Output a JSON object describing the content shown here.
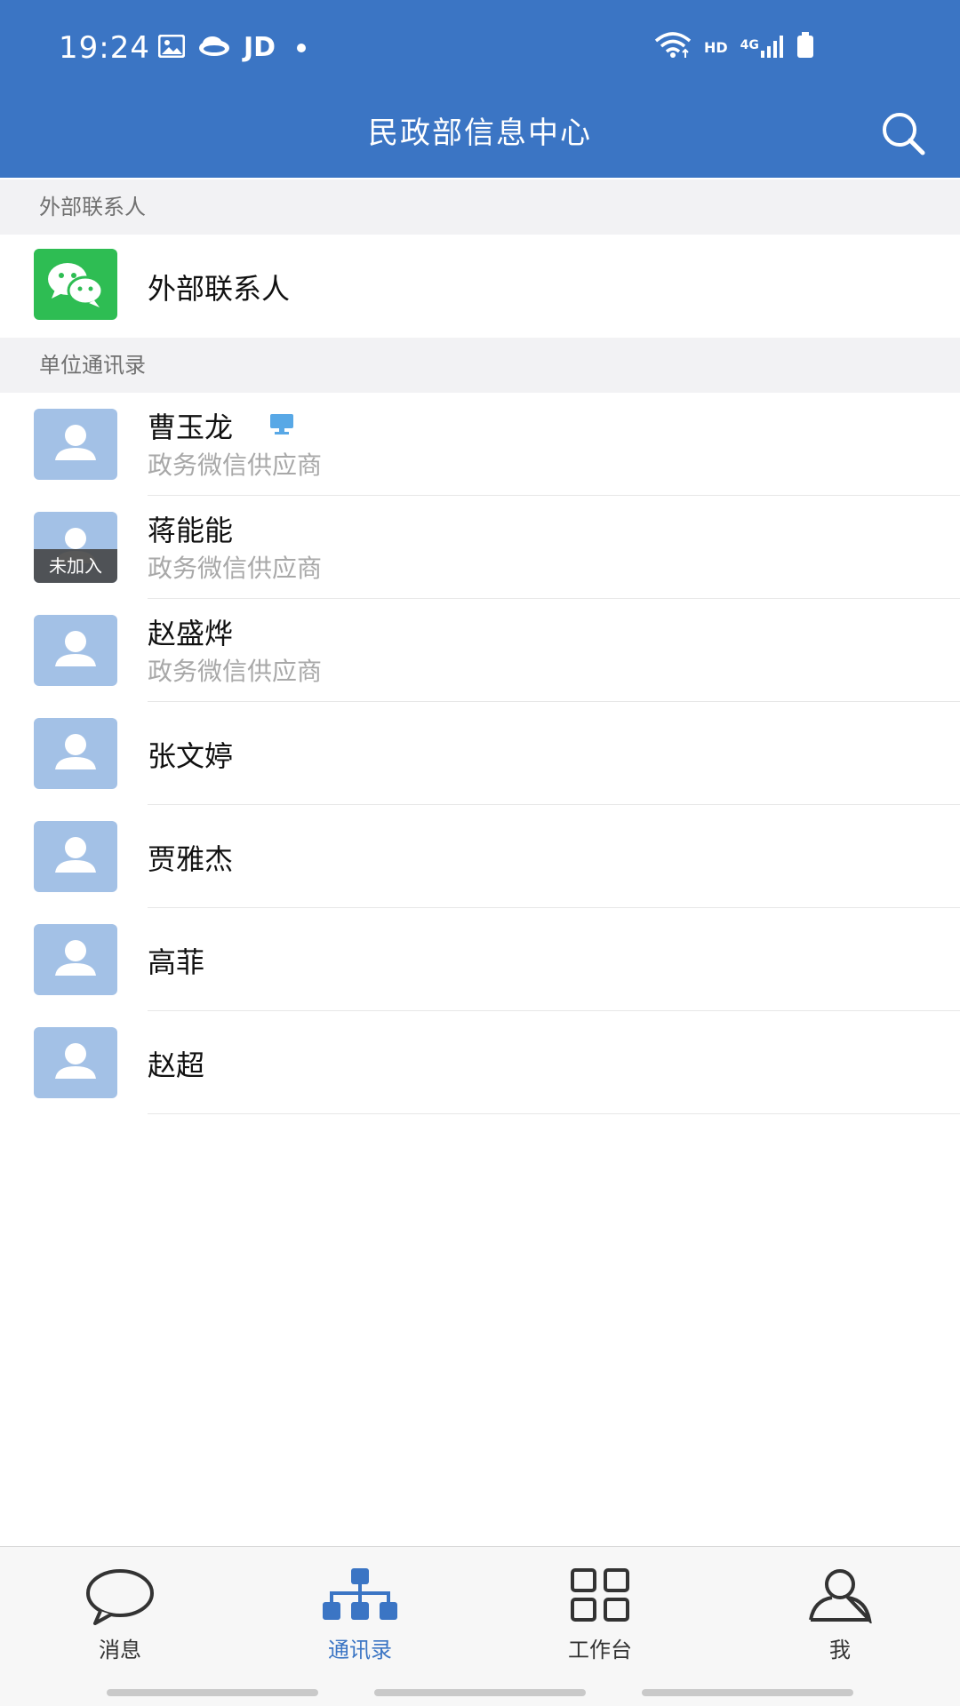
{
  "status": {
    "time": "19:24",
    "jd_label": "JD",
    "hd_label": "HD",
    "network_label": "4G"
  },
  "header": {
    "title": "民政部信息中心",
    "search_icon": "search-icon"
  },
  "sections": {
    "external": {
      "title": "外部联系人",
      "item_label": "外部联系人"
    },
    "unit": {
      "title": "单位通讯录"
    }
  },
  "contacts": [
    {
      "name": "曹玉龙",
      "subtitle": "政务微信供应商",
      "pc_online": true
    },
    {
      "name": "蒋能能",
      "subtitle": "政务微信供应商",
      "badge": "未加入"
    },
    {
      "name": "赵盛烨",
      "subtitle": "政务微信供应商"
    },
    {
      "name": "张文婷"
    },
    {
      "name": "贾雅杰"
    },
    {
      "name": "高菲"
    },
    {
      "name": "赵超"
    }
  ],
  "tabbar": {
    "tabs": [
      {
        "label": "消息",
        "icon": "chat-bubble-icon"
      },
      {
        "label": "通讯录",
        "icon": "org-chart-icon",
        "active": true
      },
      {
        "label": "工作台",
        "icon": "grid-icon"
      },
      {
        "label": "我",
        "icon": "person-outline-icon"
      }
    ]
  },
  "colors": {
    "brand_blue": "#3b75c4",
    "avatar_blue": "#a3c1e6",
    "wechat_green": "#2ebd53"
  }
}
